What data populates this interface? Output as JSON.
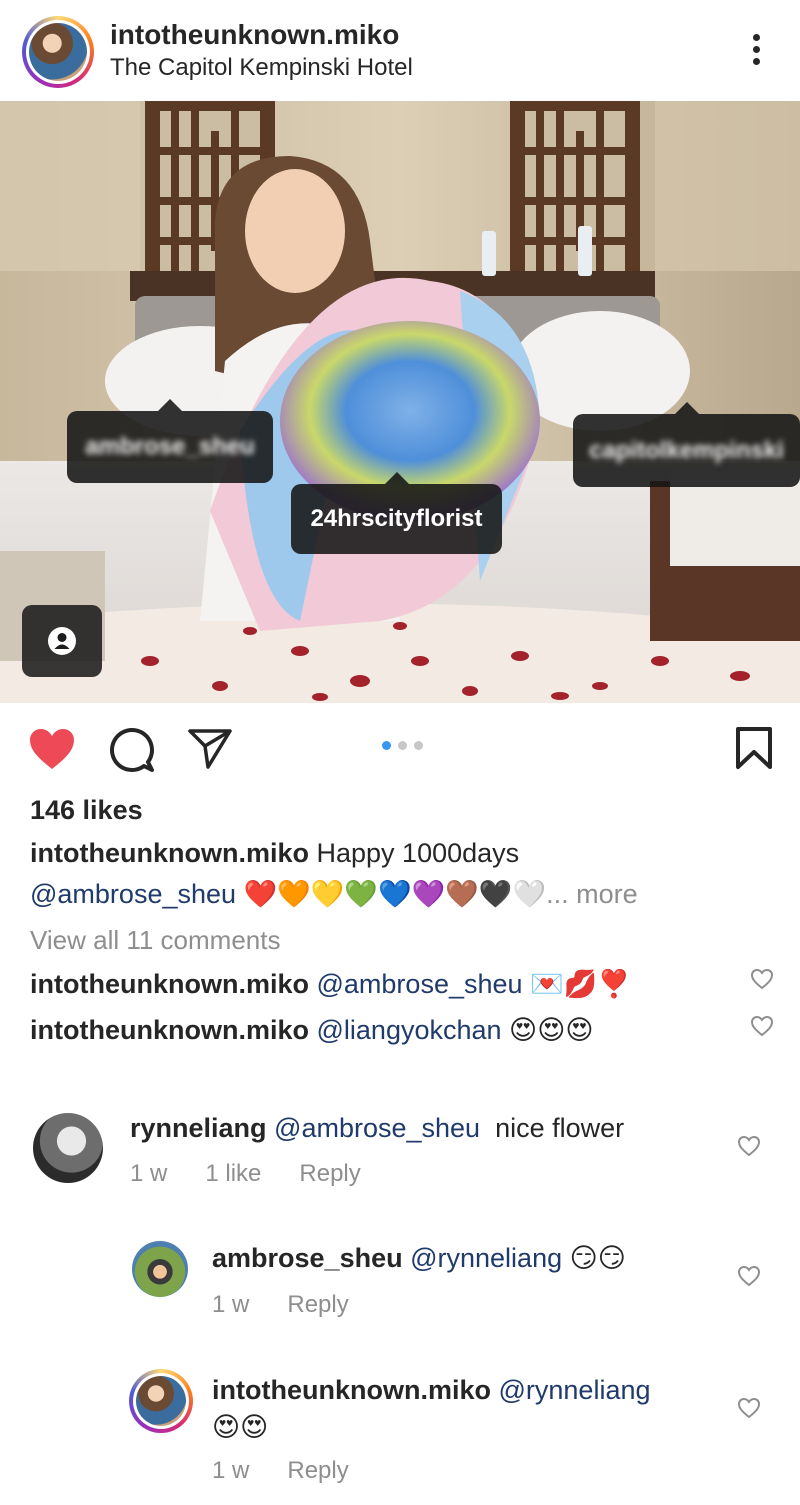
{
  "post": {
    "username": "intotheunknown.miko",
    "location": "The Capitol Kempinski Hotel"
  },
  "photo_tags": {
    "tag1": "ambrose_sheu",
    "tag2": "24hrscityflorist",
    "tag3": "capitolkempinski"
  },
  "likes": "146 likes",
  "caption": {
    "username": "intotheunknown.miko",
    "text": "Happy 1000days",
    "mention": "@ambrose_sheu",
    "hearts": "❤️🧡💛💚💙💜🤎🖤🤍",
    "more": "... more"
  },
  "view_all": "View all 11 comments",
  "preview_comments": [
    {
      "user": "intotheunknown.miko",
      "mention": "@ambrose_sheu",
      "emoji": "💌💋❣️"
    },
    {
      "user": "intotheunknown.miko",
      "mention": "@liangyokchan",
      "emoji": "😍😍😍"
    }
  ],
  "comments": [
    {
      "user": "rynneliang",
      "mention": "@ambrose_sheu",
      "text": "nice flower",
      "time": "1 w",
      "likes": "1 like",
      "reply": "Reply"
    },
    {
      "user": "ambrose_sheu",
      "mention": "@rynneliang",
      "emoji": "😏😏",
      "time": "1 w",
      "reply": "Reply"
    },
    {
      "user": "intotheunknown.miko",
      "mention": "@rynneliang",
      "emoji": "😍😍",
      "time": "1 w",
      "reply": "Reply"
    }
  ],
  "colors": {
    "like_red": "#ed4956",
    "mention_blue": "#1f3a6b",
    "carousel_active": "#3897f0"
  },
  "carousel": {
    "total": 3,
    "active_index": 0
  }
}
